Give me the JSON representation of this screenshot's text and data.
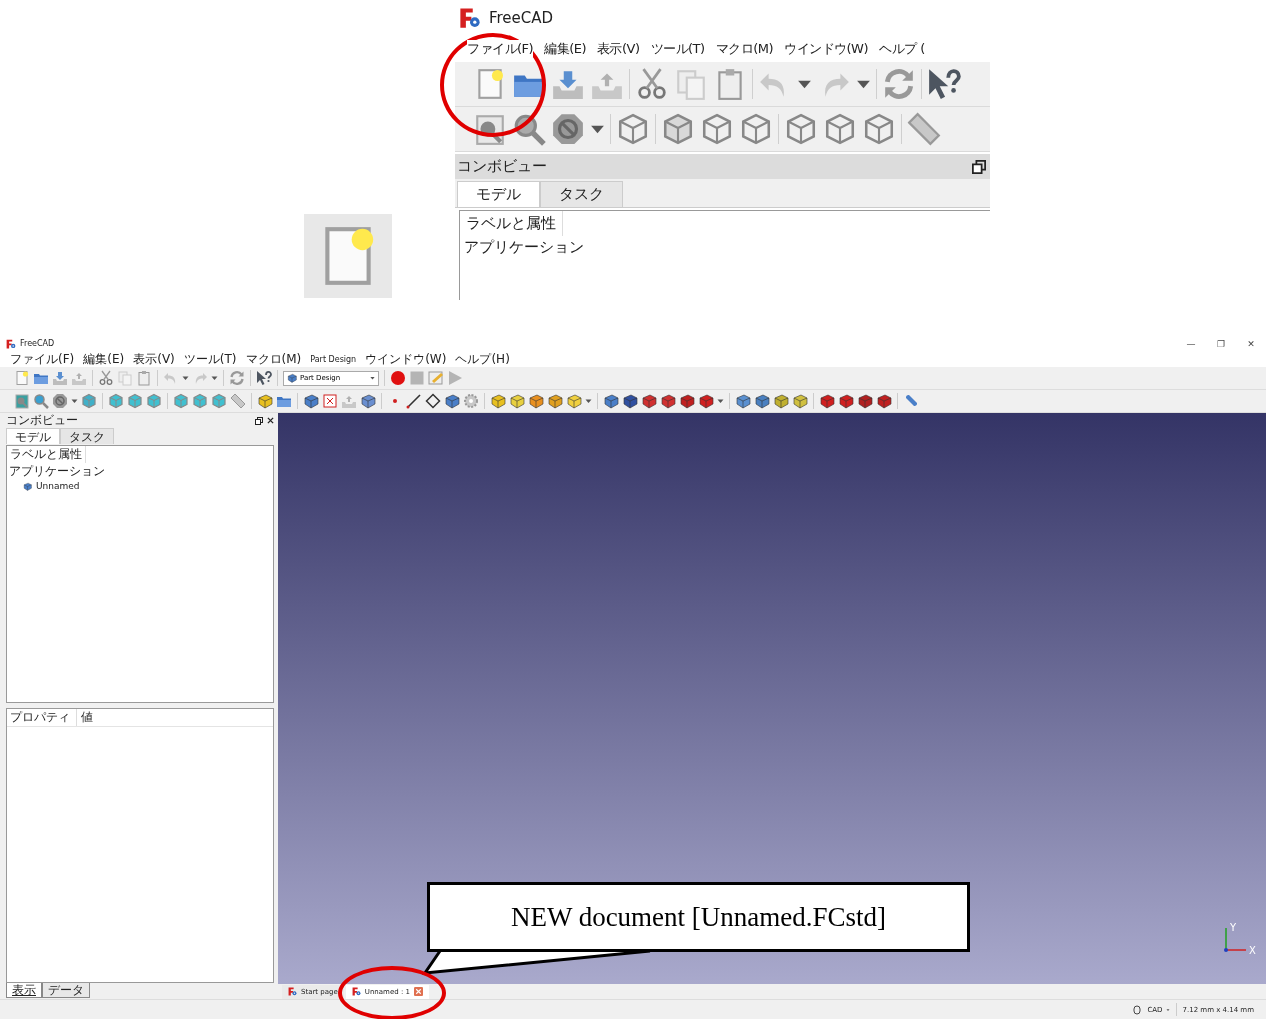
{
  "zoom_view": {
    "title": "FreeCAD",
    "menu": [
      "ファイル(F)",
      "編集(E)",
      "表示(V)",
      "ツール(T)",
      "マクロ(M)",
      "ウインドウ(W)",
      "ヘルプ ("
    ],
    "combo_view": {
      "title": "コンボビュー",
      "tabs": [
        {
          "label": "モデル",
          "selected": true
        },
        {
          "label": "タスク",
          "selected": false
        }
      ],
      "tree_header": "ラベルと属性",
      "tree_root": "アプリケーション"
    }
  },
  "window": {
    "title": "FreeCAD",
    "window_controls": [
      "—",
      "❐",
      "✕"
    ],
    "menu": [
      "ファイル(F)",
      "編集(E)",
      "表示(V)",
      "ツール(T)",
      "マクロ(M)",
      "Part Design",
      "ウインドウ(W)",
      "ヘルプ(H)"
    ],
    "workbench": "Part Design",
    "combo_view": {
      "title": "コンボビュー",
      "tabs": [
        {
          "label": "モデル",
          "selected": true
        },
        {
          "label": "タスク",
          "selected": false
        }
      ],
      "tree_header": "ラベルと属性",
      "tree_root": "アプリケーション",
      "tree_children": [
        {
          "label": "Unnamed"
        }
      ],
      "property_columns": [
        "プロパティ",
        "値"
      ],
      "bottom_tabs": [
        {
          "label": "表示",
          "selected": true
        },
        {
          "label": "データ",
          "selected": false
        }
      ]
    },
    "axis_labels": {
      "x": "X",
      "y": "Y"
    },
    "document_tabs": [
      {
        "label": "Start page",
        "selected": false,
        "closable": false
      },
      {
        "label": "Unnamed : 1",
        "selected": true,
        "closable": true
      }
    ],
    "status_bar": {
      "navigation": "CAD",
      "dimensions": "7.12 mm x 4.14 mm"
    }
  },
  "callout": {
    "text": "NEW document [Unnamed.FCstd]"
  }
}
